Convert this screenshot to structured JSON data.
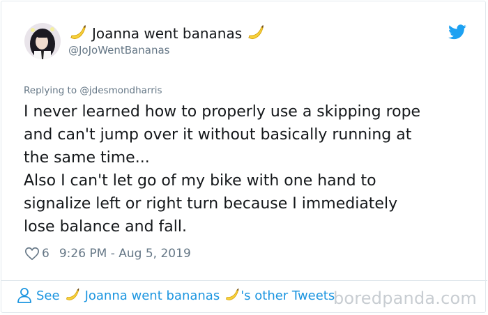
{
  "user": {
    "display_name": "Joanna went bananas",
    "handle": "@JoJoWentBananas",
    "avatar_icon": "avatar-photo",
    "name_emoji_icon": "banana-icon"
  },
  "reply": {
    "prefix": "Replying to ",
    "to_handle": "@jdesmondharris"
  },
  "tweet": {
    "lines": [
      "I never learned how to properly use a skipping rope",
      "and can't jump over it without basically running at",
      "the same time...",
      "Also I can't let go of my bike with one hand to",
      "signalize left or right turn because I immediately",
      "lose balance and fall."
    ]
  },
  "meta": {
    "likes": "6",
    "timestamp": "9:26 PM - Aug 5, 2019"
  },
  "footer": {
    "see_label": "See",
    "name": "Joanna went bananas",
    "suffix": "'s other Tweets"
  },
  "watermark": "boredpanda.com",
  "colors": {
    "link": "#1b95e0",
    "twitter_blue": "#1da1f2",
    "secondary_text": "#657786",
    "border": "#e1e8ed"
  }
}
